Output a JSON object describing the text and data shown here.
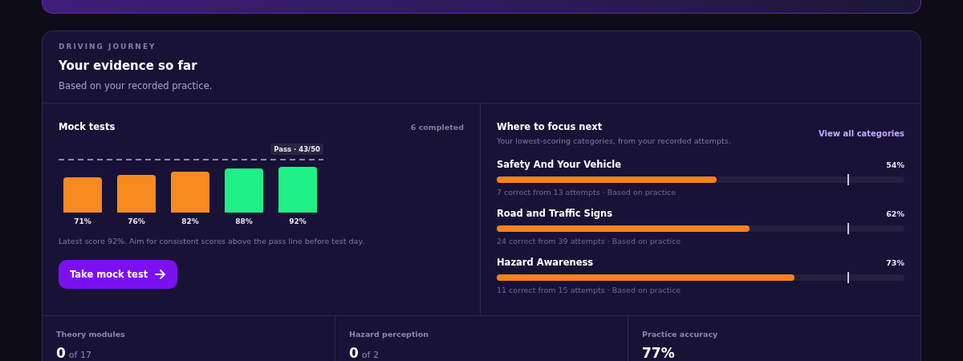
{
  "journey": {
    "eyebrow": "DRIVING JOURNEY",
    "title": "Your evidence so far",
    "subtitle": "Based on your recorded practice."
  },
  "mock_tests": {
    "title": "Mock tests",
    "count": "6 completed",
    "pass_label": "Pass · 43/50",
    "scores": [
      {
        "label": "71%",
        "passed": false
      },
      {
        "label": "76%",
        "passed": false
      },
      {
        "label": "82%",
        "passed": false
      },
      {
        "label": "88%",
        "passed": true
      },
      {
        "label": "92%",
        "passed": true
      }
    ],
    "note": "Latest score 92%. Aim for consistent scores above the pass line before test day.",
    "button": "Take mock test"
  },
  "focus": {
    "title": "Where to focus next",
    "subtitle": "Your lowest-scoring categories, from your recorded attempts.",
    "link": "View all categories",
    "categories": [
      {
        "name": "Safety And Your Vehicle",
        "reading": "54%",
        "level": 0.54,
        "detail": "7 correct from 13 attempts · Based on practice"
      },
      {
        "name": "Road and Traffic Signs",
        "reading": "62%",
        "level": 0.62,
        "detail": "24 correct from 39 attempts · Based on practice"
      },
      {
        "name": "Hazard Awareness",
        "reading": "73%",
        "level": 0.73,
        "detail": "11 correct from 15 attempts · Based on practice"
      }
    ]
  },
  "stats": [
    {
      "label": "Theory modules",
      "value": "0",
      "total": "of 17"
    },
    {
      "label": "Hazard perception",
      "value": "0",
      "total": "of 2"
    },
    {
      "label": "Practice accuracy",
      "value": "77%"
    }
  ]
}
